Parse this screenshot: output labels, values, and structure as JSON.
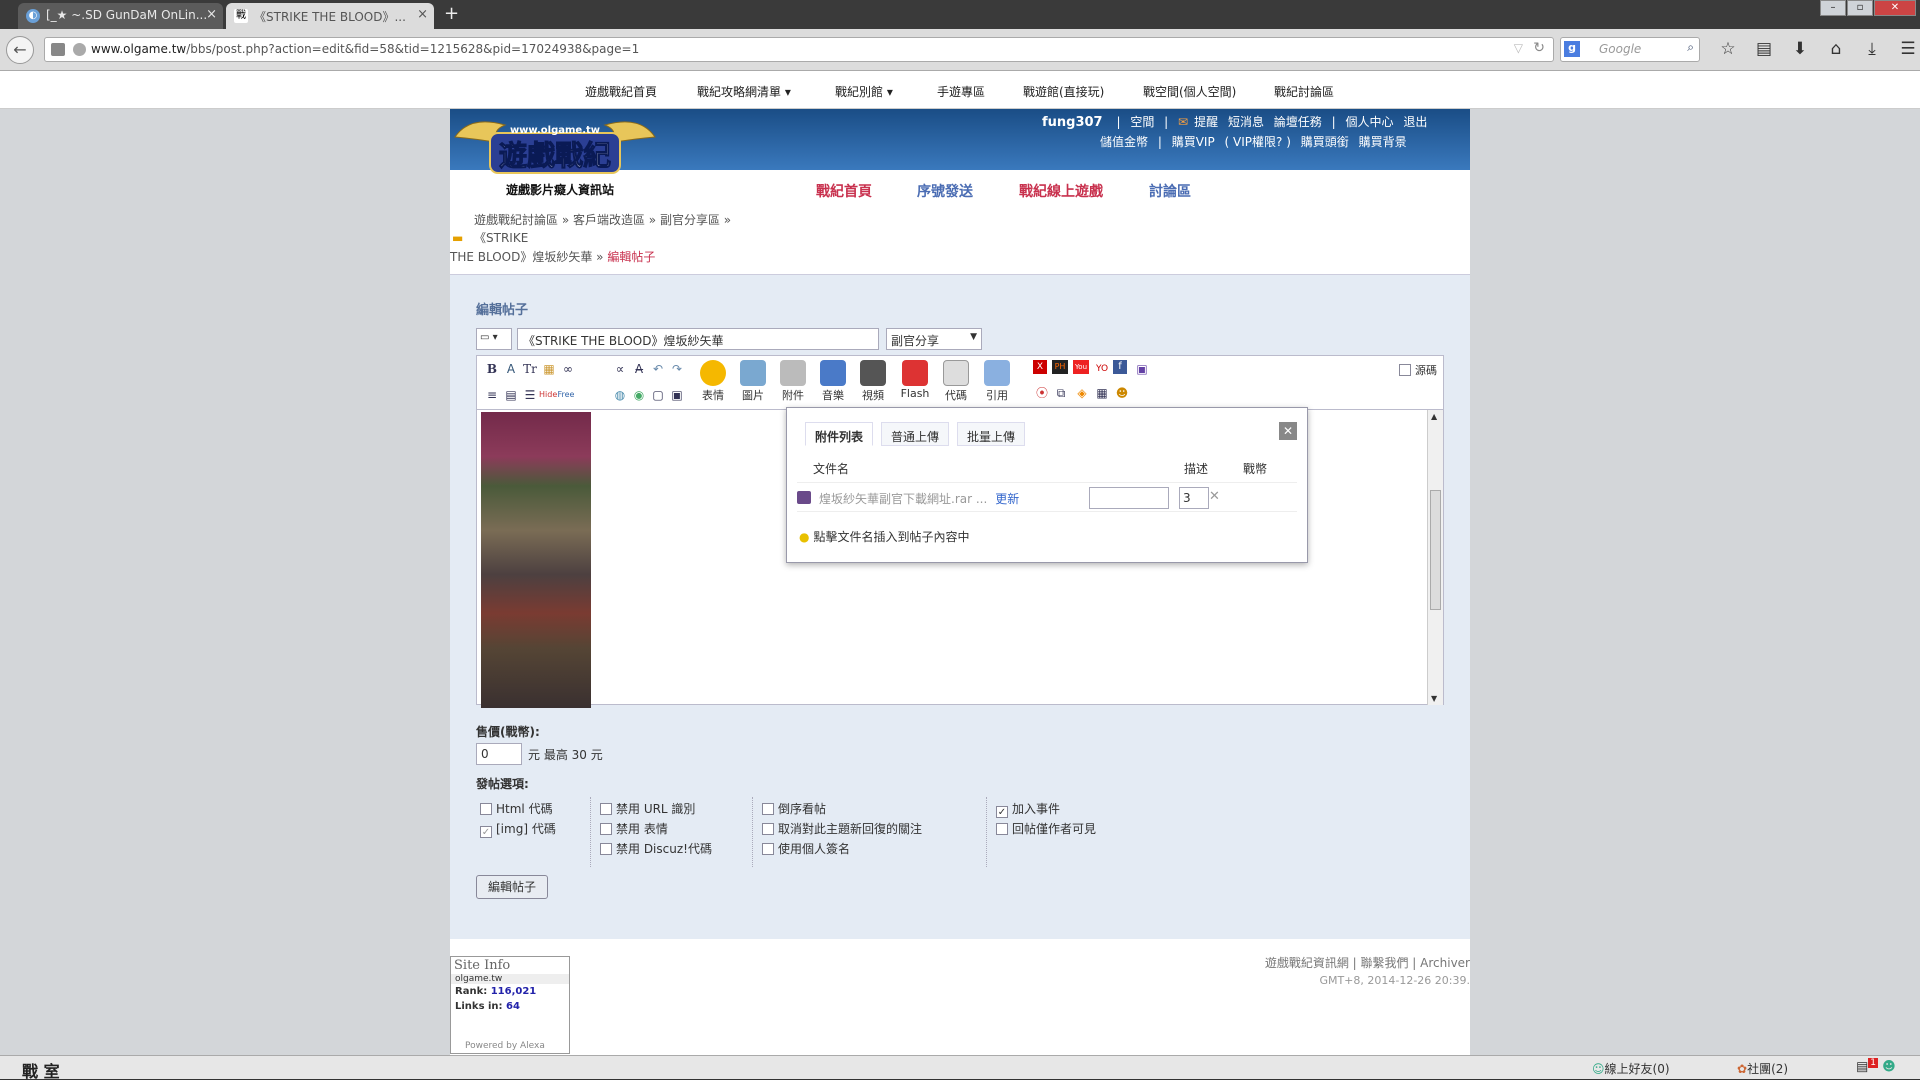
{
  "browser": {
    "tabs": [
      {
        "label": "[_★ ~.SD GunDaM OnLin...",
        "icon": "site-favicon"
      },
      {
        "label": "《STRIKE THE BLOOD》...",
        "icon": "olgame-favicon"
      }
    ],
    "url_domain": "www.olgame.tw",
    "url_path": "/bbs/post.php?action=edit&fid=58&tid=1215628&pid=17024938&page=1",
    "search_placeholder": "Google"
  },
  "site_nav": [
    "遊戲戰紀首頁",
    "戰紀攻略網清單",
    "戰紀別館",
    "手遊專區",
    "戰遊館(直接玩)",
    "戰空間(個人空間)",
    "戰紀討論區"
  ],
  "header": {
    "logo_site": "www.olgame.tw",
    "logo_title": "遊戲戰紀",
    "logo_sub": "遊戲影片癡人資訊站",
    "username": "fung307",
    "user_links": [
      "空間",
      "提醒",
      "短消息",
      "論壇任務",
      "個人中心",
      "退出"
    ],
    "user_links2": [
      "儲值金幣",
      "購買VIP",
      "( VIP權限? )",
      "購買頭銜",
      "購買背景"
    ],
    "main_nav": [
      {
        "label": "戰紀首頁",
        "color": "#c8314e"
      },
      {
        "label": "序號發送",
        "color": "#4a6cb3"
      },
      {
        "label": "戰紀線上遊戲",
        "color": "#c8314e"
      },
      {
        "label": "討論區",
        "color": "#4a6cb3"
      }
    ]
  },
  "breadcrumb": {
    "line1": "遊戲戰紀討論區 » 客戶端改造區 » 副官分享區 » 《STRIKE",
    "line2": "THE BLOOD》煌坂紗矢華 »",
    "current": "編輯帖子"
  },
  "editor": {
    "title": "編輯帖子",
    "subject": "《STRIKE THE BLOOD》煌坂紗矢華",
    "forum": "副官分享",
    "source_label": "源碼",
    "tools_small": [
      "B",
      "A",
      "Tr",
      "▦",
      "∞",
      "≡",
      "▤",
      "☰",
      "Hide",
      "Free"
    ],
    "tools_big": [
      "表情",
      "圖片",
      "附件",
      "音樂",
      "視頻",
      "Flash",
      "代碼",
      "引用"
    ]
  },
  "attach_popup": {
    "tabs": [
      "附件列表",
      "普通上傳",
      "批量上傳"
    ],
    "col_name": "文件名",
    "col_desc": "描述",
    "col_price": "戰幣",
    "file": "煌坂紗矢華副官下載網址.rar ...",
    "update": "更新",
    "price": "3",
    "tip": "點擊文件名插入到帖子內容中"
  },
  "sale": {
    "label": "售價(戰幣):",
    "value": "0",
    "text": "元 最高 30 元"
  },
  "options": {
    "title": "發帖選項:",
    "col1": [
      {
        "label": "Html 代碼",
        "checked": false
      },
      {
        "label": "[img] 代碼",
        "checked": true
      }
    ],
    "col2": [
      {
        "label": "禁用 URL 識別",
        "checked": false
      },
      {
        "label": "禁用 表情",
        "checked": false
      },
      {
        "label": "禁用 Discuz!代碼",
        "checked": false
      }
    ],
    "col3": [
      {
        "label": "倒序看帖",
        "checked": false
      },
      {
        "label": "取消對此主題新回復的關注",
        "checked": false
      },
      {
        "label": "使用個人簽名",
        "checked": false
      }
    ],
    "col4": [
      {
        "label": "加入事件",
        "checked": true
      },
      {
        "label": "回帖僅作者可見",
        "checked": false
      }
    ]
  },
  "submit_label": "編輯帖子",
  "footer": {
    "siteinfo_title": "Site Info",
    "siteinfo_url": "olgame.tw",
    "rank_label": "Rank:",
    "rank": "116,021",
    "links_label": "Links in:",
    "links": "64",
    "powered": "Powered by Alexa",
    "links_text": "遊戲戰紀資訊網 | 聯繫我們 | Archiver",
    "date": "GMT+8, 2014-12-26 20:39."
  },
  "statusbar": {
    "left": "戰 室",
    "friends": "線上好友(0)",
    "groups": "社團(2)",
    "notif": "1"
  }
}
